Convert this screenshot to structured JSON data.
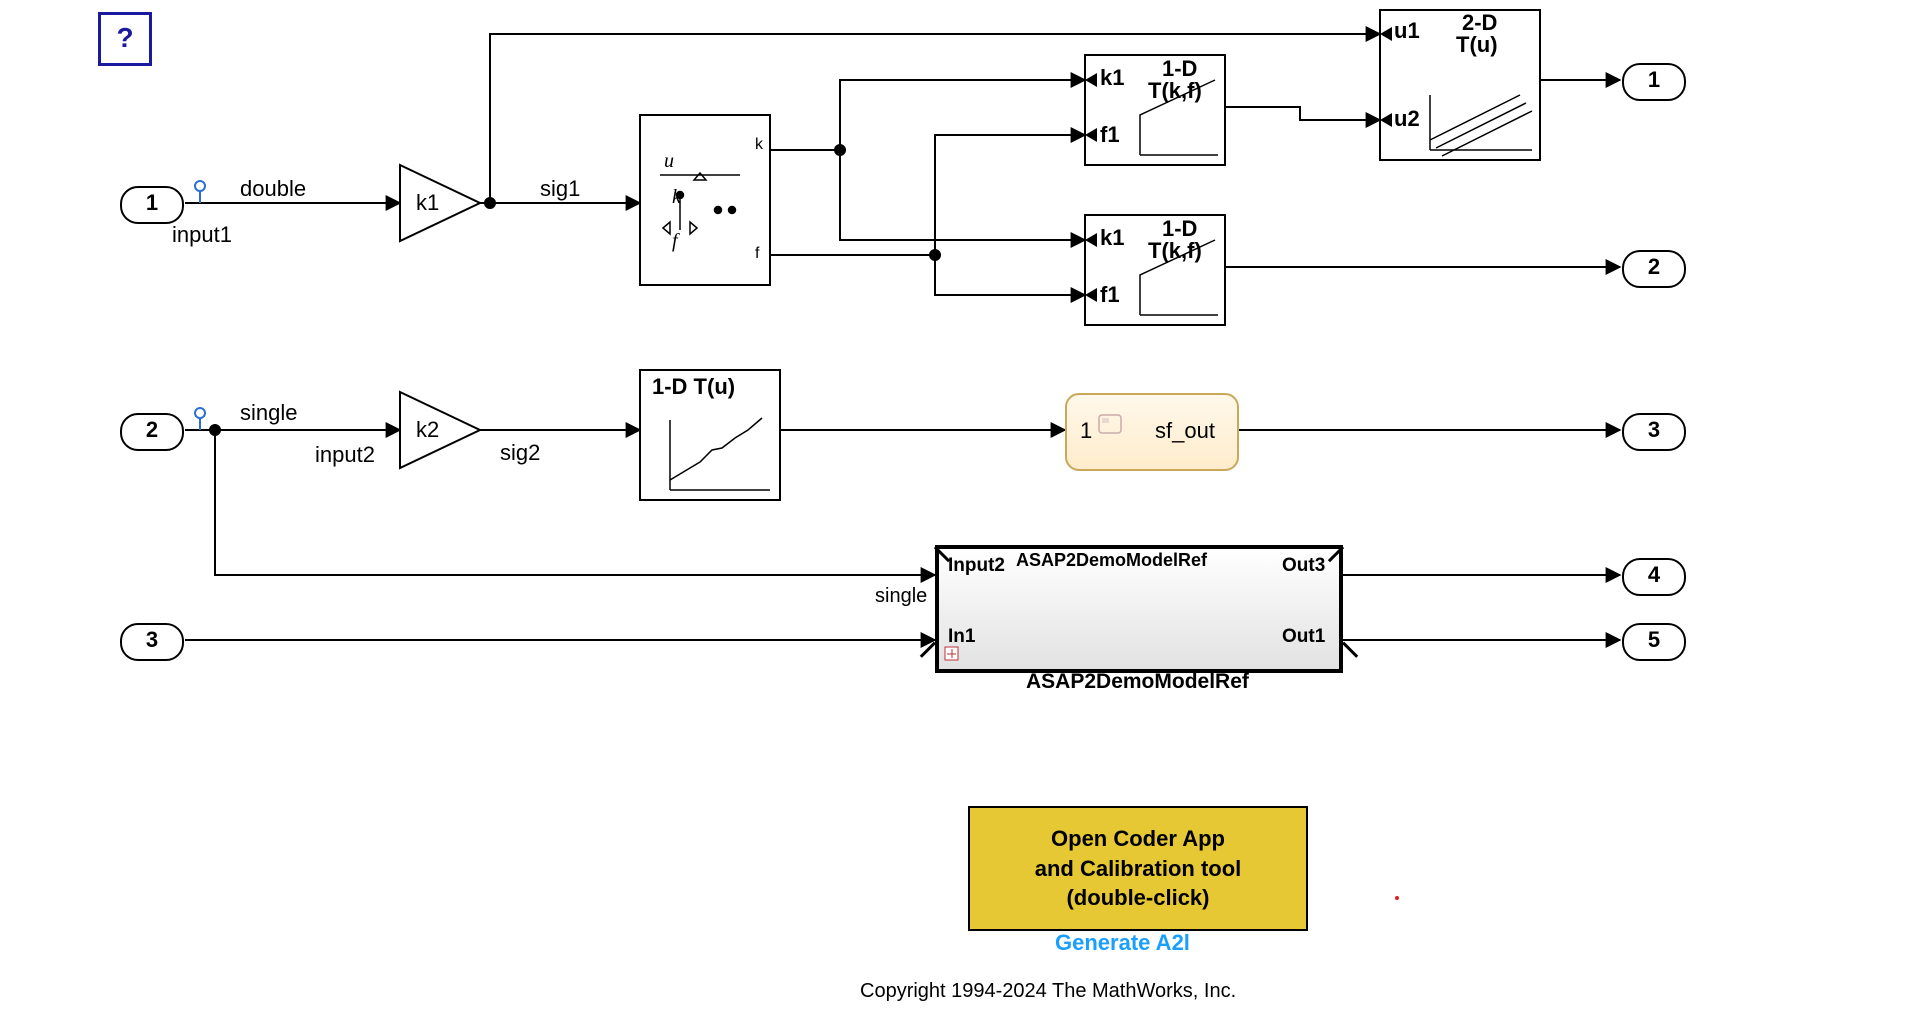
{
  "help_button": "?",
  "inports": {
    "p1": {
      "num": "1",
      "name": "input1",
      "dtype": "double"
    },
    "p2": {
      "num": "2",
      "name": "input2",
      "dtype": "single"
    },
    "p3": {
      "num": "3"
    }
  },
  "outports": {
    "o1": "1",
    "o2": "2",
    "o3": "3",
    "o4": "4",
    "o5": "5"
  },
  "gains": {
    "g1": "k1",
    "g2": "k2"
  },
  "signals": {
    "s1": "sig1",
    "s2": "sig2"
  },
  "prelookup": {
    "u": "u",
    "k": "k",
    "f": "f",
    "out_k": "k",
    "out_f": "f"
  },
  "interp1d_a": {
    "k": "k1",
    "f": "f1",
    "title1": "1-D",
    "title2": "T(k,f)"
  },
  "interp1d_b": {
    "k": "k1",
    "f": "f1",
    "title1": "1-D",
    "title2": "T(k,f)"
  },
  "lookup2d": {
    "u1": "u1",
    "u2": "u2",
    "title1": "2-D",
    "title2": "T(u)"
  },
  "lookup1d": {
    "title": "1-D T(u)"
  },
  "sf": {
    "in": "1",
    "out": "sf_out"
  },
  "modelref": {
    "name": "ASAP2DemoModelRef",
    "label": "ASAP2DemoModelRef",
    "in1": "Input2",
    "in2": "In1",
    "out1": "Out3",
    "out2": "Out1",
    "dtype": "single"
  },
  "callout": {
    "l1": "Open Coder App",
    "l2": "and Calibration tool",
    "l3": "(double-click)"
  },
  "generate_label": "Generate A2l",
  "copyright": "Copyright 1994-2024 The MathWorks, Inc."
}
